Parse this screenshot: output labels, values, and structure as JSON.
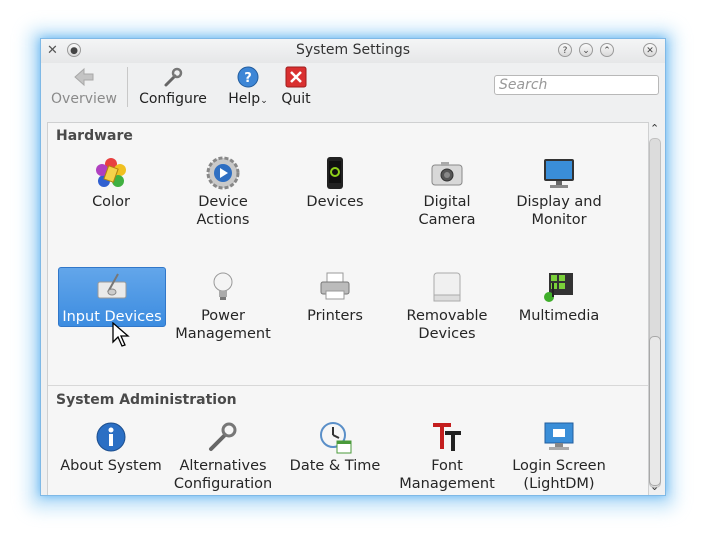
{
  "window": {
    "title": "System Settings"
  },
  "toolbar": {
    "overview": "Overview",
    "configure": "Configure",
    "help": "Help",
    "quit": "Quit",
    "search_placeholder": "Search"
  },
  "groups": [
    {
      "title": "Hardware",
      "items": [
        {
          "l1": "Color",
          "l2": "",
          "icon": "color-icon"
        },
        {
          "l1": "Device",
          "l2": "Actions",
          "icon": "device-actions-icon"
        },
        {
          "l1": "Devices",
          "l2": "",
          "icon": "devices-icon"
        },
        {
          "l1": "Digital",
          "l2": "Camera",
          "icon": "camera-icon"
        },
        {
          "l1": "Display and",
          "l2": "Monitor",
          "icon": "monitor-icon"
        },
        {
          "l1": "Input Devices",
          "l2": "",
          "icon": "input-devices-icon",
          "selected": true
        },
        {
          "l1": "Power",
          "l2": "Management",
          "icon": "power-icon"
        },
        {
          "l1": "Printers",
          "l2": "",
          "icon": "printer-icon"
        },
        {
          "l1": "Removable",
          "l2": "Devices",
          "icon": "removable-icon"
        },
        {
          "l1": "Multimedia",
          "l2": "",
          "icon": "multimedia-icon"
        }
      ]
    },
    {
      "title": "System Administration",
      "items": [
        {
          "l1": "About System",
          "l2": "",
          "icon": "info-icon"
        },
        {
          "l1": "Alternatives",
          "l2": "Configuration",
          "icon": "wrench-icon"
        },
        {
          "l1": "Date & Time",
          "l2": "",
          "icon": "clock-icon"
        },
        {
          "l1": "Font",
          "l2": "Management",
          "icon": "font-icon"
        },
        {
          "l1": "Login Screen",
          "l2": "(LightDM)",
          "icon": "login-icon"
        }
      ]
    }
  ],
  "colors": {
    "accent": "#3c8ce0",
    "window_border": "#7fb9e6"
  }
}
